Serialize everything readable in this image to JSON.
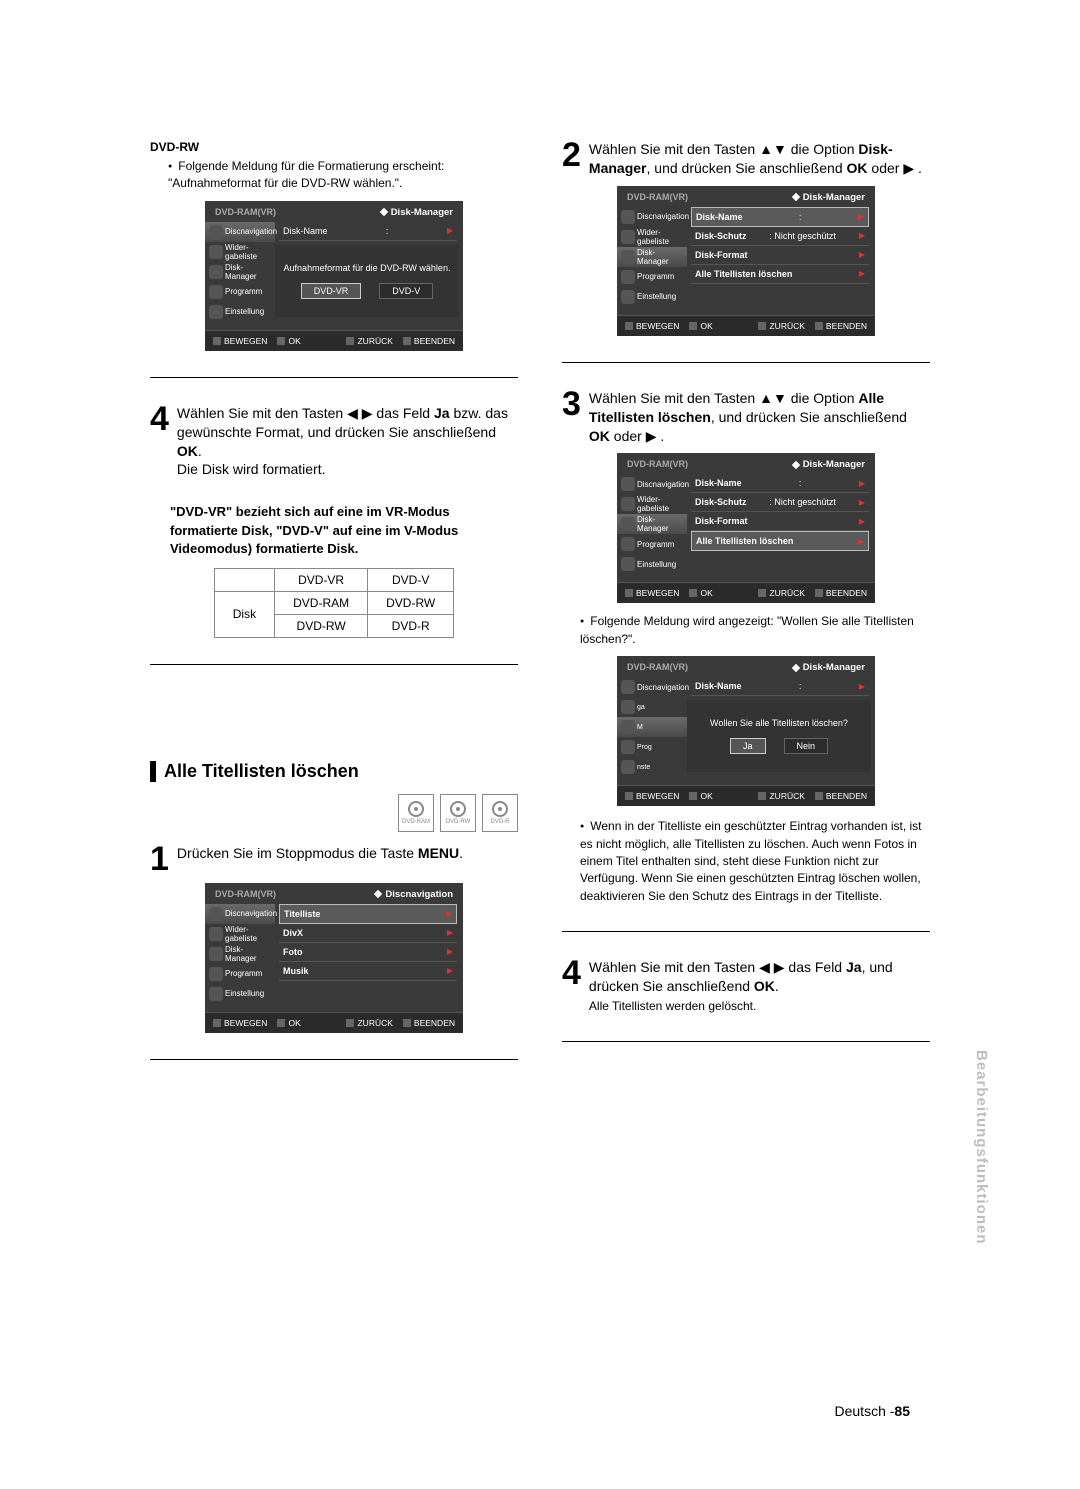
{
  "left": {
    "heading_1": "DVD-RW",
    "bullet_1": "Folgende Meldung für die Formatierung erscheint: \"Aufnahmeformat für die DVD-RW wählen.\".",
    "osd1": {
      "mode": "DVD-RAM(VR)",
      "breadcrumb": "Disk-Manager",
      "rows": {
        "r0": "Disk-Name",
        "r0v": ":"
      },
      "overlay_text": "Aufnahmeformat für die DVD-RW wählen.",
      "btn_a": "DVD-VR",
      "btn_b": "DVD-V"
    },
    "step4": {
      "num": "4",
      "l1": "Wählen Sie mit den Tasten ◀ ▶ das Feld ",
      "ja": "Ja",
      "l2": " bzw. das gewünschte Format, und drücken Sie anschließend ",
      "ok": "OK",
      "l3": ".",
      "l4": "Die Disk wird formatiert."
    },
    "note": "\"DVD-VR\" bezieht sich auf eine im VR-Modus formatierte Disk, \"DVD-V\" auf eine im V-Modus Videomodus) formatierte Disk.",
    "table": {
      "h1": "DVD-VR",
      "h2": "DVD-V",
      "r": "Disk",
      "a1": "DVD-RAM",
      "a2": "DVD-RW",
      "b1": "DVD-RW",
      "b2": "DVD-R"
    },
    "section": "Alle Titellisten löschen",
    "discs": {
      "a": "DVD-RAM",
      "b": "DVD-RW",
      "c": "DVD-R"
    },
    "step1": {
      "num": "1",
      "l1": "Drücken Sie im Stoppmodus die Taste ",
      "menu": "MENU",
      "l2": "."
    },
    "osd2": {
      "mode": "DVD-RAM(VR)",
      "breadcrumb": "Discnavigation",
      "r0": "Titelliste",
      "r1": "DivX",
      "r2": "Foto",
      "r3": "Musik"
    }
  },
  "right": {
    "step2": {
      "num": "2",
      "l1": "Wählen Sie mit den Tasten ▲▼ die Option ",
      "t": "Disk-Manager",
      "l2": ", und drücken Sie anschließend ",
      "ok": "OK",
      "l3": " oder ▶ ."
    },
    "osd3": {
      "mode": "DVD-RAM(VR)",
      "breadcrumb": "Disk-Manager",
      "r0": "Disk-Name",
      "r0v": ":",
      "r1": "Disk-Schutz",
      "r1v": ": Nicht geschützt",
      "r2": "Disk-Format",
      "r3": "Alle Titellisten löschen"
    },
    "step3": {
      "num": "3",
      "l1": "Wählen Sie mit den Tasten ▲▼ die Option ",
      "t": "Alle Titellisten löschen",
      "l2": ", und drücken Sie anschließend ",
      "ok": "OK",
      "l3": " oder ▶ ."
    },
    "osd4": {
      "mode": "DVD-RAM(VR)",
      "breadcrumb": "Disk-Manager",
      "r0": "Disk-Name",
      "r0v": ":",
      "r1": "Disk-Schutz",
      "r1v": ": Nicht geschützt",
      "r2": "Disk-Format",
      "r3": "Alle Titellisten löschen"
    },
    "bullet_a": "Folgende Meldung wird angezeigt: \"Wollen Sie alle Titellisten löschen?\".",
    "osd5": {
      "mode": "DVD-RAM(VR)",
      "breadcrumb": "Disk-Manager",
      "r0": "Disk-Name",
      "r0v": ":",
      "overlay_text": "Wollen Sie alle Titellisten löschen?",
      "btn_a": "Ja",
      "btn_b": "Nein"
    },
    "bullet_b": "Wenn in der Titelliste ein geschützter Eintrag vorhanden ist, ist es nicht möglich, alle Titellisten zu löschen. Auch wenn Fotos in einem Titel enthalten sind, steht diese Funktion nicht zur Verfügung. Wenn Sie einen geschützten Eintrag löschen wollen, deaktivieren Sie den Schutz des Eintrags in der Titelliste.",
    "step4": {
      "num": "4",
      "l1": "Wählen Sie mit den Tasten ◀ ▶ das Feld ",
      "ja": "Ja",
      "l2": ", und drücken Sie anschließend ",
      "ok": "OK",
      "l3": ".",
      "l4": "Alle Titellisten werden gelöscht."
    }
  },
  "side": {
    "s0": "Discnavigation",
    "s1": "Wider-\ngabeliste",
    "s2": "Disk-\nManager",
    "s3": "Programm",
    "s4": "Einstellung"
  },
  "foot": {
    "a": "BEWEGEN",
    "b": "OK",
    "c": "ZURÜCK",
    "d": "BEENDEN"
  },
  "sidebar_label": "Bearbeitungsfunktionen",
  "page": {
    "lang": "Deutsch -",
    "num": "85"
  }
}
